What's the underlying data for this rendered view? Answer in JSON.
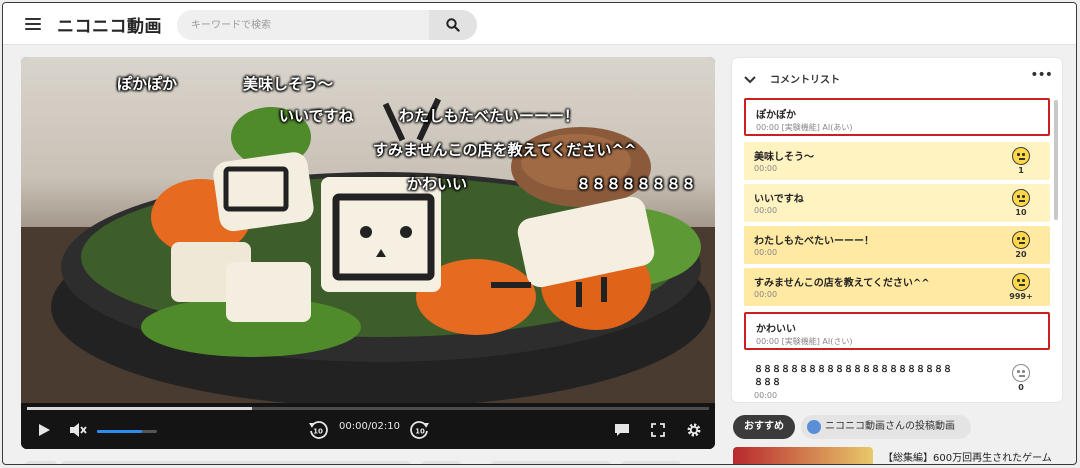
{
  "header": {
    "logo": "ニコニコ動画",
    "search_placeholder": "キーワードで検索"
  },
  "player": {
    "danmaku": [
      {
        "text": "ぽかぽか"
      },
      {
        "text": "美味しそう〜"
      },
      {
        "text": "いいですね"
      },
      {
        "text": "わたしもたべたいーーー！"
      },
      {
        "text": "すみませんこの店を教えてください^^"
      },
      {
        "text": "かわいい"
      },
      {
        "text": "８８８８８８８８"
      }
    ],
    "time": "00:00/02:10",
    "progress_fraction": 0.0,
    "buffered_fraction": 0.33,
    "volume_fraction": 0.75,
    "muted": true
  },
  "panel": {
    "title": "コメントリスト",
    "more": "•••",
    "comments": [
      {
        "text": "ぽかぽか",
        "meta": "00:00 [実験機能] AI(あい)",
        "style": "outlined"
      },
      {
        "text": "美味しそう〜",
        "meta": "00:00",
        "count": "1",
        "style": "yellow"
      },
      {
        "text": "いいですね",
        "meta": "00:00",
        "count": "10",
        "style": "yellow"
      },
      {
        "text": "わたしもたべたいーーー！",
        "meta": "00:00",
        "count": "20",
        "style": "yellow2"
      },
      {
        "text": "すみませんこの店を教えてください^^",
        "meta": "00:00",
        "count": "999+",
        "style": "yellow2"
      },
      {
        "text": "かわいい",
        "meta": "00:00 [実験機能] AI(さい)",
        "style": "outlined"
      },
      {
        "text": "８８８８８８８８８８８８８８８８８８８８８８",
        "text2": "８８８",
        "meta": "00:00",
        "count": "0",
        "style": "plain"
      }
    ]
  },
  "tabs": {
    "recommend": "おすすめ",
    "uploads": "ニコニコ動画さんの投稿動画"
  },
  "recommend": {
    "first_title": "【総集編】600万回再生されたゲーム"
  }
}
